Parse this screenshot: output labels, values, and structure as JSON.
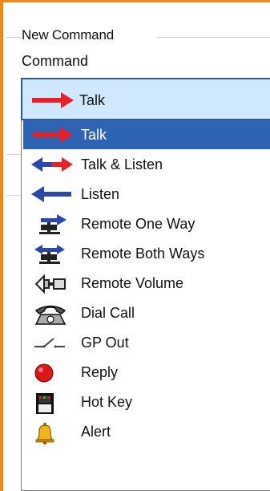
{
  "group": {
    "title": "New Command"
  },
  "command": {
    "label": "Command",
    "selected_value": "Talk"
  },
  "dropdown": {
    "items": [
      {
        "label": "Talk",
        "icon": "talk-arrow-icon",
        "selected": true
      },
      {
        "label": "Talk & Listen",
        "icon": "talk-listen-arrow-icon",
        "selected": false
      },
      {
        "label": "Listen",
        "icon": "listen-arrow-icon",
        "selected": false
      },
      {
        "label": "Remote One Way",
        "icon": "remote-one-way-icon",
        "selected": false
      },
      {
        "label": "Remote Both Ways",
        "icon": "remote-both-ways-icon",
        "selected": false
      },
      {
        "label": "Remote Volume",
        "icon": "remote-volume-icon",
        "selected": false
      },
      {
        "label": "Dial Call",
        "icon": "telephone-icon",
        "selected": false
      },
      {
        "label": "GP Out",
        "icon": "switch-icon",
        "selected": false
      },
      {
        "label": "Reply",
        "icon": "red-ball-icon",
        "selected": false
      },
      {
        "label": "Hot Key",
        "icon": "hot-key-icon",
        "selected": false
      },
      {
        "label": "Alert",
        "icon": "bell-icon",
        "selected": false
      }
    ]
  },
  "colors": {
    "frame": "#ef8a1a",
    "selection": "#2f63b4",
    "combo_bg": "#cfe8fb",
    "talk_red": "#e8202a",
    "listen_blue": "#2a48a8"
  }
}
